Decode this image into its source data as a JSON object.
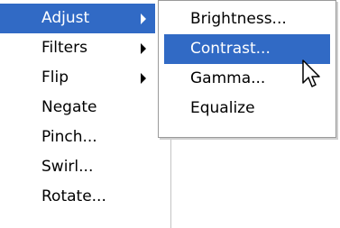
{
  "main_menu": {
    "items": [
      {
        "label": "Adjust",
        "submenu": true,
        "selected": true
      },
      {
        "label": "Filters",
        "submenu": true,
        "selected": false
      },
      {
        "label": "Flip",
        "submenu": true,
        "selected": false
      },
      {
        "label": "Negate",
        "submenu": false,
        "selected": false
      },
      {
        "label": "Pinch...",
        "submenu": false,
        "selected": false
      },
      {
        "label": "Swirl...",
        "submenu": false,
        "selected": false
      },
      {
        "label": "Rotate...",
        "submenu": false,
        "selected": false
      }
    ]
  },
  "sub_menu": {
    "items": [
      {
        "label": "Brightness...",
        "selected": false
      },
      {
        "label": "Contrast...",
        "selected": true
      },
      {
        "label": "Gamma...",
        "selected": false
      },
      {
        "label": "Equalize",
        "selected": false
      }
    ]
  },
  "icons": {
    "submenu_arrow": "triangle-right-icon",
    "cursor": "mouse-pointer-icon"
  },
  "colors": {
    "highlight": "#316ac5",
    "highlight_text": "#ffffff",
    "text": "#000000",
    "menu_background": "#ffffff"
  }
}
